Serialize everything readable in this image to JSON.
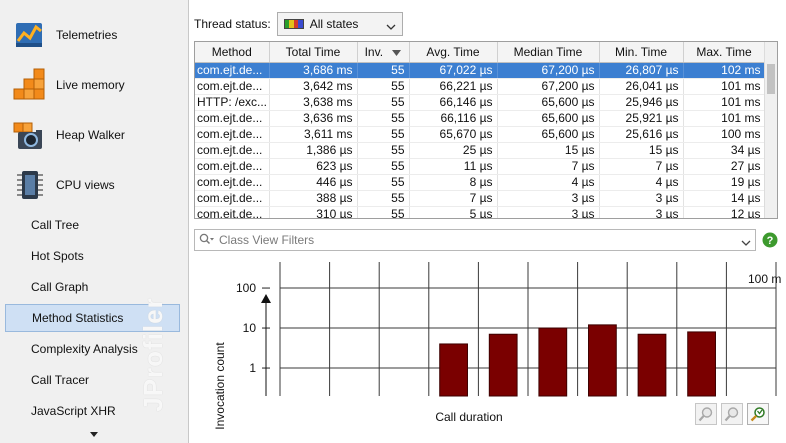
{
  "sidebar": {
    "top_items": [
      {
        "label": "Telemetries",
        "icon": "telemetries-icon"
      },
      {
        "label": "Live memory",
        "icon": "live-memory-icon"
      },
      {
        "label": "Heap Walker",
        "icon": "heap-walker-icon"
      },
      {
        "label": "CPU views",
        "icon": "cpu-views-icon"
      }
    ],
    "sub_items": [
      {
        "label": "Call Tree",
        "selected": false
      },
      {
        "label": "Hot Spots",
        "selected": false
      },
      {
        "label": "Call Graph",
        "selected": false
      },
      {
        "label": "Method Statistics",
        "selected": true
      },
      {
        "label": "Complexity Analysis",
        "selected": false
      },
      {
        "label": "Call Tracer",
        "selected": false
      },
      {
        "label": "JavaScript XHR",
        "selected": false
      }
    ],
    "watermark": "JProfiler"
  },
  "thread_status": {
    "label": "Thread status:",
    "value": "All states",
    "swatch_colors": [
      "#2a9d2a",
      "#e2c21b",
      "#d23a2a",
      "#3a4bd0"
    ]
  },
  "table": {
    "columns": [
      "Method",
      "Total Time",
      "Inv.",
      "Avg. Time",
      "Median Time",
      "Min. Time",
      "Max. Time"
    ],
    "sort_column": "Inv.",
    "sort_direction": "descending",
    "rows": [
      [
        "com.ejt.de...",
        "3,686 ms",
        "55",
        "67,022 µs",
        "67,200 µs",
        "26,807 µs",
        "102 ms"
      ],
      [
        "com.ejt.de...",
        "3,642 ms",
        "55",
        "66,221 µs",
        "67,200 µs",
        "26,041 µs",
        "101 ms"
      ],
      [
        "HTTP: /exc...",
        "3,638 ms",
        "55",
        "66,146 µs",
        "65,600 µs",
        "25,946 µs",
        "101 ms"
      ],
      [
        "com.ejt.de...",
        "3,636 ms",
        "55",
        "66,116 µs",
        "65,600 µs",
        "25,921 µs",
        "101 ms"
      ],
      [
        "com.ejt.de...",
        "3,611 ms",
        "55",
        "65,670 µs",
        "65,600 µs",
        "25,616 µs",
        "100 ms"
      ],
      [
        "com.ejt.de...",
        "1,386 µs",
        "55",
        "25 µs",
        "15 µs",
        "15 µs",
        "34 µs"
      ],
      [
        "com.ejt.de...",
        "623 µs",
        "55",
        "11 µs",
        "7 µs",
        "7 µs",
        "27 µs"
      ],
      [
        "com.ejt.de...",
        "446 µs",
        "55",
        "8 µs",
        "4 µs",
        "4 µs",
        "19 µs"
      ],
      [
        "com.ejt.de...",
        "388 µs",
        "55",
        "7 µs",
        "3 µs",
        "3 µs",
        "14 µs"
      ],
      [
        "com.ejt.de...",
        "310 µs",
        "55",
        "5 µs",
        "3 µs",
        "3 µs",
        "12 µs"
      ]
    ],
    "selected_row": 0
  },
  "filter": {
    "placeholder": "Class View Filters",
    "value": ""
  },
  "chart_data": {
    "type": "bar",
    "xlabel": "Call duration",
    "ylabel": "Invocation count",
    "yscale": "log",
    "ylim": [
      0.2,
      200
    ],
    "yticks": [
      "100",
      "10",
      "1"
    ],
    "ytick_values": [
      100,
      10,
      1
    ],
    "x_annotation": "100 m",
    "bar_color": "#7a0000",
    "bin_count": 10,
    "values": [
      0,
      0,
      0,
      4,
      7,
      10,
      12,
      7,
      8,
      0
    ]
  },
  "zoom_buttons": [
    {
      "name": "zoom-in-button",
      "icon": "zoom-in-icon",
      "active": false
    },
    {
      "name": "zoom-out-button",
      "icon": "zoom-out-icon",
      "active": false
    },
    {
      "name": "zoom-fit-button",
      "icon": "zoom-fit-icon",
      "active": true
    }
  ]
}
